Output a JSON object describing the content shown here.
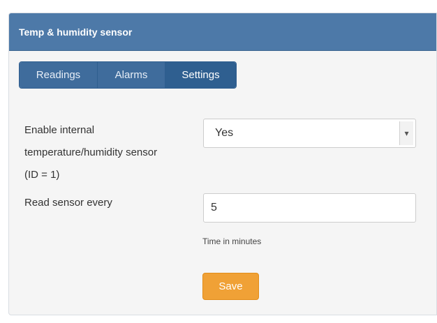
{
  "panel": {
    "title": "Temp & humidity sensor"
  },
  "tabs": [
    {
      "label": "Readings",
      "active": false
    },
    {
      "label": "Alarms",
      "active": false
    },
    {
      "label": "Settings",
      "active": true
    }
  ],
  "form": {
    "enable_label_line1": "Enable internal",
    "enable_label_line2": "temperature/humidity sensor",
    "enable_label_line3": "(ID = 1)",
    "enable_value": "Yes",
    "read_label": "Read sensor every",
    "read_value": "5",
    "read_help": "Time in minutes",
    "save_label": "Save"
  },
  "colors": {
    "header": "#4d79a8",
    "tab_bg": "#3f6c9c",
    "tab_active_bg": "#2f5f90",
    "button": "#f0a136",
    "panel_bg": "#f5f5f5"
  },
  "icons": {
    "select_arrow": "chevron-down-icon"
  }
}
